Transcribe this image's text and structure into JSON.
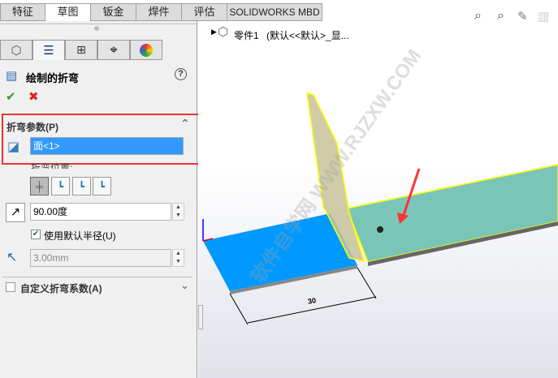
{
  "tabs": [
    "特征",
    "草图",
    "钣金",
    "焊件",
    "评估",
    "SOLIDWORKS MBD"
  ],
  "active_tab": "草图",
  "panel": {
    "title": "绘制的折弯",
    "section1": {
      "title": "折弯参数(P)",
      "selection": "面<1>",
      "position_label": "折弯位置:",
      "angle": "90.00度",
      "use_default_radius": "使用默认半径(U)",
      "use_default_radius_checked": true,
      "radius": "3.00mm"
    },
    "section2": {
      "title": "自定义折弯系数(A)",
      "checked": false
    }
  },
  "tree": {
    "part": "零件1",
    "config": "(默认<<默认>_显..."
  },
  "viewport": {
    "dimension": "30",
    "watermark": "软件自学网 WWW.RJZXW.COM",
    "colors": {
      "selected_face": "#0099ff",
      "bend_face": "#79c6b8",
      "highlight": "#ffff00",
      "callout": "#ff3333"
    }
  }
}
